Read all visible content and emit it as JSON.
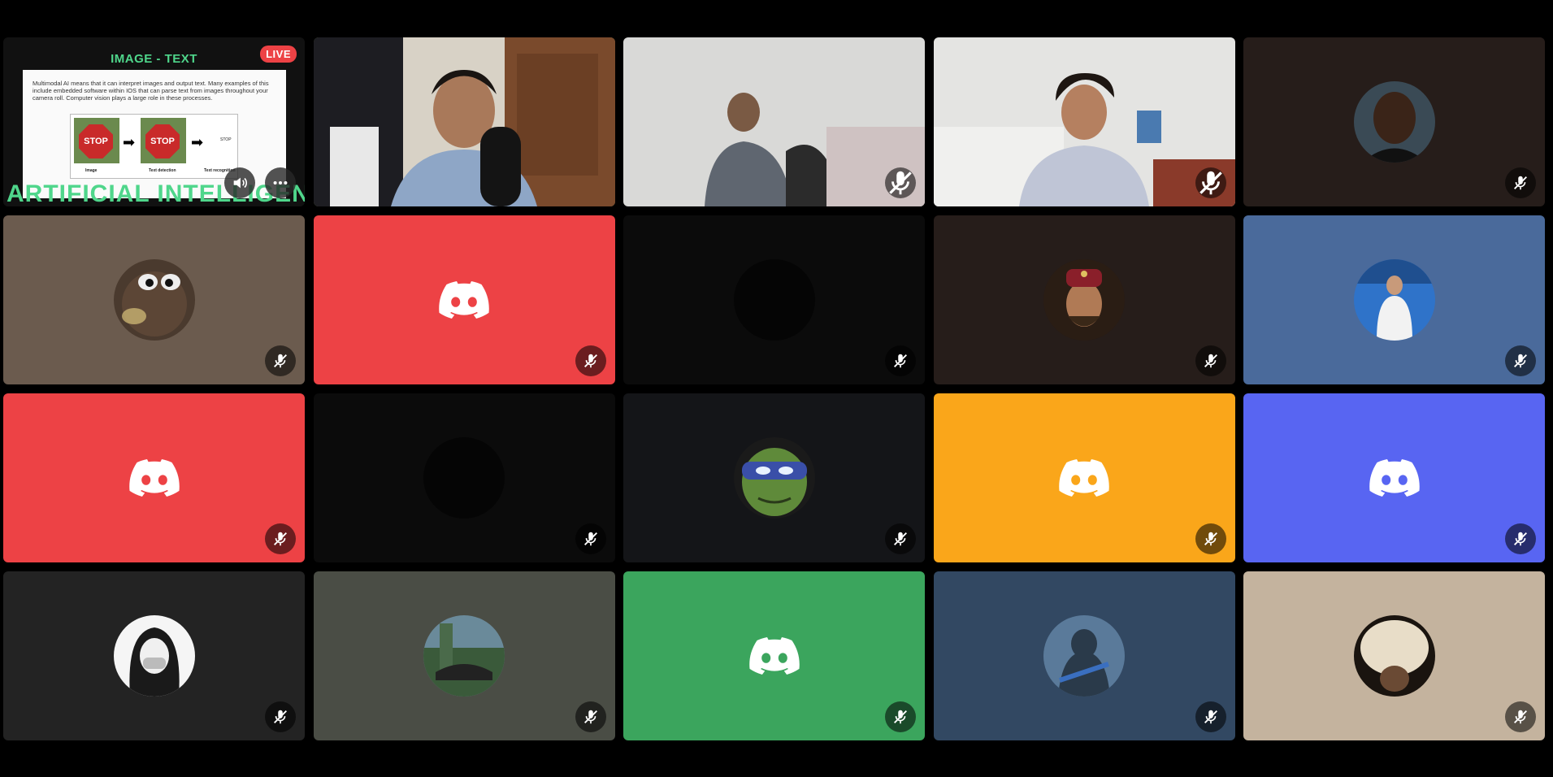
{
  "screen_share": {
    "live_badge": "LIVE",
    "slide_title": "IMAGE - TEXT",
    "slide_body": "Multimodal AI means that it can interpret images and output text. Many examples of this include embedded software within IOS that can parse text from images throughout your camera roll. Computer vision plays a large role in these processes.",
    "stop_sign_text": "STOP",
    "stop_sign_text_2": "STOP",
    "caption_1": "Image",
    "caption_2": "Text detection",
    "caption_3": "Text recognition",
    "output_text": "STOP",
    "banner": "ARTIFICIAL INTELLIGENCE (AI)",
    "volume_icon": "speaker-icon",
    "more_icon": "more-icon"
  },
  "tiles": [
    {
      "kind": "screen-share"
    },
    {
      "kind": "video",
      "speaking": true
    },
    {
      "kind": "video",
      "muted": true
    },
    {
      "kind": "video",
      "muted": true
    },
    {
      "kind": "avatar",
      "bg": "#261d1a",
      "muted": true
    },
    {
      "kind": "avatar",
      "bg": "#6b5b4e",
      "muted": true
    },
    {
      "kind": "discord",
      "bg": "#ed4245",
      "muted": true
    },
    {
      "kind": "avatar",
      "bg": "#0b0b0b",
      "muted": true
    },
    {
      "kind": "avatar",
      "bg": "#261d1a",
      "muted": true
    },
    {
      "kind": "avatar",
      "bg": "#4a6a9b",
      "muted": true
    },
    {
      "kind": "discord",
      "bg": "#ed4245",
      "muted": true
    },
    {
      "kind": "avatar",
      "bg": "#0b0b0b",
      "muted": true
    },
    {
      "kind": "avatar",
      "bg": "#141518",
      "muted": true
    },
    {
      "kind": "discord",
      "bg": "#faa61a",
      "muted": true
    },
    {
      "kind": "discord",
      "bg": "#5865f2",
      "muted": true
    },
    {
      "kind": "avatar",
      "bg": "#232323",
      "muted": true
    },
    {
      "kind": "avatar",
      "bg": "#4a4d45",
      "muted": true
    },
    {
      "kind": "discord",
      "bg": "#3ba55d",
      "muted": true
    },
    {
      "kind": "avatar",
      "bg": "#324862",
      "muted": true
    },
    {
      "kind": "avatar",
      "bg": "#c4b39e",
      "muted": true
    }
  ],
  "colors": {
    "speaking_outline": "#3ba55d",
    "live_badge": "#ed4245",
    "slide_accent": "#4fd68b"
  },
  "icons": {
    "muted": "mic-muted-icon",
    "discord": "discord-logo-icon"
  }
}
